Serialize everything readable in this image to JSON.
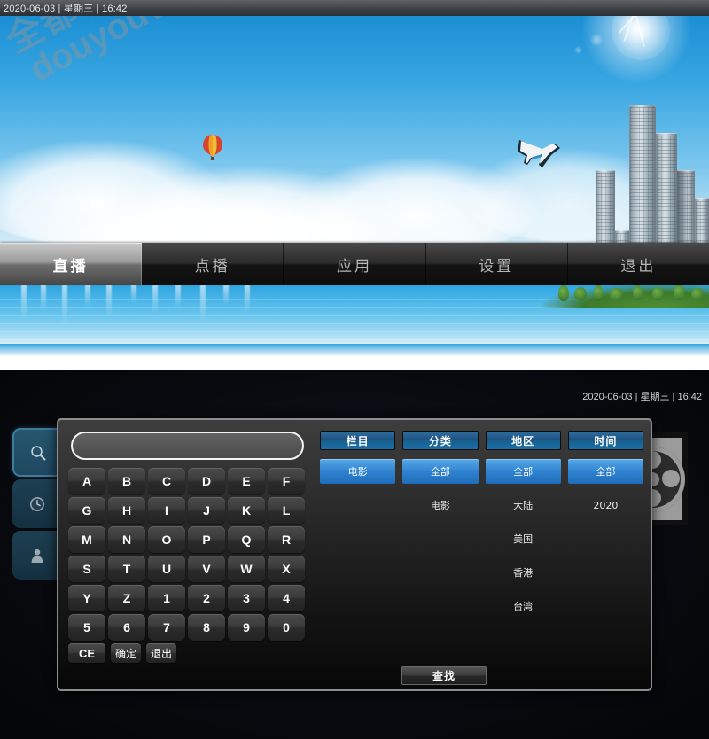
{
  "statusbar": {
    "datetime": "2020-06-03 | 星期三 | 16:42"
  },
  "watermark": {
    "cn": "全都有综合资源网",
    "en": "douyouvip.com"
  },
  "nav": {
    "items": [
      {
        "label": "直播",
        "active": true
      },
      {
        "label": "点播",
        "active": false
      },
      {
        "label": "应用",
        "active": false
      },
      {
        "label": "设置",
        "active": false
      },
      {
        "label": "退出",
        "active": false
      }
    ]
  },
  "bottom": {
    "datetime": "2020-06-03 | 星期三 | 16:42"
  },
  "sidebar": {
    "items": [
      {
        "icon": "search-icon",
        "active": true
      },
      {
        "icon": "clock-icon",
        "active": false
      },
      {
        "icon": "user-icon",
        "active": false
      }
    ]
  },
  "search": {
    "value": "",
    "placeholder": ""
  },
  "keyboard": {
    "rows": [
      [
        "A",
        "B",
        "C",
        "D",
        "E",
        "F"
      ],
      [
        "G",
        "H",
        "I",
        "J",
        "K",
        "L"
      ],
      [
        "M",
        "N",
        "O",
        "P",
        "Q",
        "R"
      ],
      [
        "S",
        "T",
        "U",
        "V",
        "W",
        "X"
      ],
      [
        "Y",
        "Z",
        "1",
        "2",
        "3",
        "4"
      ],
      [
        "5",
        "6",
        "7",
        "8",
        "9",
        "0"
      ]
    ],
    "functions": [
      "CE",
      "确定",
      "退出"
    ]
  },
  "filters": {
    "columns": [
      {
        "header": "栏目",
        "options": [
          {
            "label": "电影",
            "selected": true
          },
          {
            "label": "",
            "selected": false
          },
          {
            "label": "",
            "selected": false
          },
          {
            "label": "",
            "selected": false
          },
          {
            "label": "",
            "selected": false
          }
        ]
      },
      {
        "header": "分类",
        "options": [
          {
            "label": "全部",
            "selected": true
          },
          {
            "label": "电影",
            "selected": false
          },
          {
            "label": "",
            "selected": false
          },
          {
            "label": "",
            "selected": false
          },
          {
            "label": "",
            "selected": false
          }
        ]
      },
      {
        "header": "地区",
        "options": [
          {
            "label": "全部",
            "selected": true
          },
          {
            "label": "大陆",
            "selected": false
          },
          {
            "label": "美国",
            "selected": false
          },
          {
            "label": "香港",
            "selected": false
          },
          {
            "label": "台湾",
            "selected": false
          }
        ]
      },
      {
        "header": "时间",
        "options": [
          {
            "label": "全部",
            "selected": true
          },
          {
            "label": "2020",
            "selected": false
          },
          {
            "label": "",
            "selected": false
          },
          {
            "label": "",
            "selected": false
          },
          {
            "label": "",
            "selected": false
          }
        ]
      }
    ],
    "find_label": "查找"
  },
  "colors": {
    "accent_blue": "#2f82cf",
    "header_blue": "#1a6ea6",
    "sidebar_teal": "#1d3f52",
    "nav_active": "#9a9a9a"
  }
}
